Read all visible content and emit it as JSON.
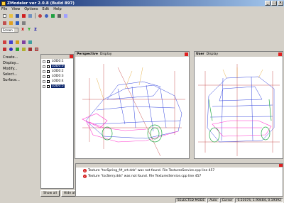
{
  "window": {
    "title": "ZModeler ver 2.0.8 (Build 897)"
  },
  "menu": [
    "File",
    "View",
    "Options",
    "Edit",
    "Help"
  ],
  "toolbar": {
    "screen_combo": "Screen"
  },
  "left_menu": [
    "Create...",
    "Display...",
    "Modify...",
    "Select...",
    "Surface..."
  ],
  "tree": {
    "items": [
      {
        "label": "LOD0:1",
        "selected": false
      },
      {
        "label": "LOD0:0",
        "selected": true
      },
      {
        "label": "LOD0:2",
        "selected": false
      },
      {
        "label": "LOD0:3",
        "selected": false
      },
      {
        "label": "LOD0:4",
        "selected": false
      },
      {
        "label": "LOD0:5",
        "selected": true
      }
    ],
    "show_all": "Show all",
    "hide_all": "Hide all"
  },
  "viewports": {
    "perspective": {
      "name": "Perspective",
      "menu": "Display"
    },
    "user": {
      "name": "User",
      "menu": "Display"
    }
  },
  "log": [
    "Texture \"tscSpring_f#_srt.dds\" was not found. File TexturesService.cpp line 457",
    "Texture \"tscSerry.dds\" was not found. File TexturesService.cpp line 457"
  ],
  "status": {
    "mode": "SELECTED MODE",
    "auto": "Auto",
    "cursor_label": "Cursor",
    "cursor": "0.53074, 1.90484, 0.19392"
  },
  "colors": {
    "title_start": "#0a246a",
    "selection": "#0a246a",
    "error": "#d01010",
    "wireframe_blue": "#3344dd",
    "wireframe_magenta": "#ff33cc",
    "wireframe_green": "#22aa44"
  }
}
